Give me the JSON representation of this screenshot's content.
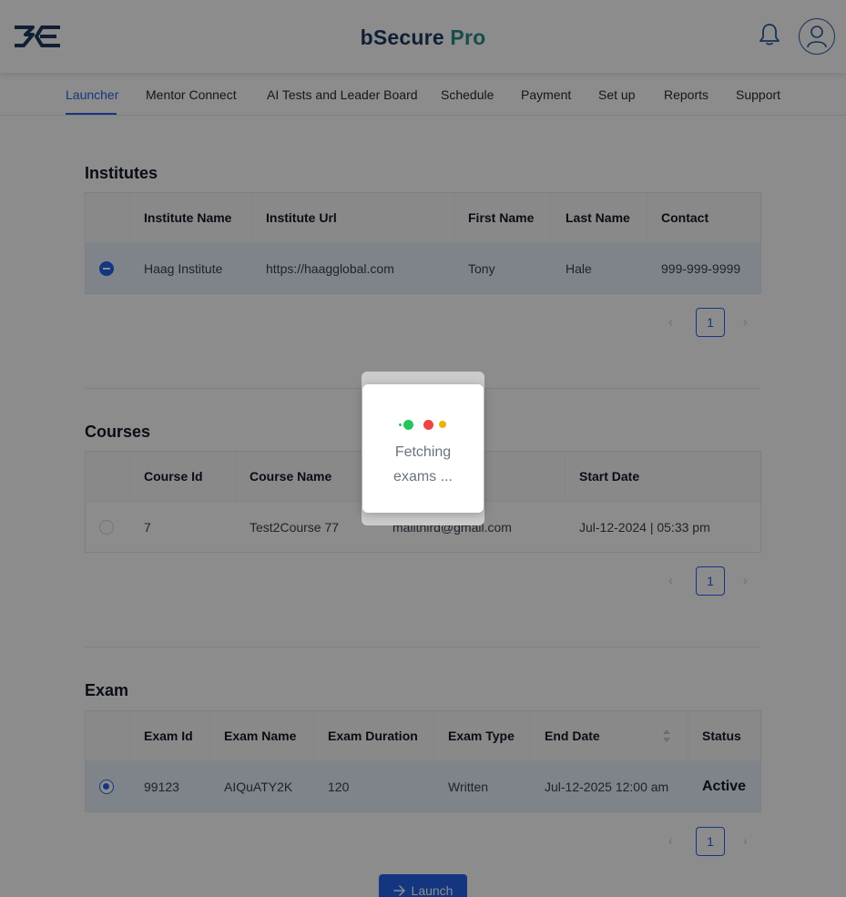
{
  "header": {
    "title": "bSecure",
    "title_pro": "Pro"
  },
  "nav": {
    "tabs": [
      {
        "label": "Launcher"
      },
      {
        "label": "Mentor Connect"
      },
      {
        "label": "AI Tests and Leader Board"
      },
      {
        "label": "Schedule"
      },
      {
        "label": "Payment"
      },
      {
        "label": "Set up"
      },
      {
        "label": "Reports"
      },
      {
        "label": "Support"
      }
    ]
  },
  "institutes": {
    "title": "Institutes",
    "columns": [
      "Institute Name",
      "Institute Url",
      "First Name",
      "Last Name",
      "Contact"
    ],
    "rows": [
      {
        "name": "Haag Institute",
        "url": "https://haagglobal.com",
        "first": "Tony",
        "last": "Hale",
        "contact": "999-999-9999"
      }
    ],
    "page": "1"
  },
  "courses": {
    "title": "Courses",
    "columns": [
      "Course Id",
      "Course Name",
      "",
      "Start Date"
    ],
    "rows": [
      {
        "id": "7",
        "name": "Test2Course 77",
        "email": "mailthird@gmail.com",
        "start": "Jul-12-2024 | 05:33 pm"
      }
    ],
    "page": "1"
  },
  "exam": {
    "title": "Exam",
    "columns": [
      "Exam Id",
      "Exam Name",
      "Exam Duration",
      "Exam Type",
      "End Date",
      "Status"
    ],
    "rows": [
      {
        "id": "99123",
        "name": "AIQuATY2K",
        "duration": "120",
        "type": "Written",
        "end": "Jul-12-2025 12:00 am",
        "status": "Active"
      }
    ],
    "page": "1"
  },
  "launch_button": "Launch",
  "loader": {
    "line1": "Fetching",
    "line2": "exams ..."
  },
  "colors": {
    "accent": "#2563eb",
    "brand_dark": "#1e3a5f",
    "brand_teal": "#2a8a8a",
    "dot_green": "#22c55e",
    "dot_red": "#ef4444",
    "dot_yellow": "#eab308"
  },
  "pager_prev_icon": "chevron-left-icon",
  "pager_next_icon": "chevron-right-icon"
}
